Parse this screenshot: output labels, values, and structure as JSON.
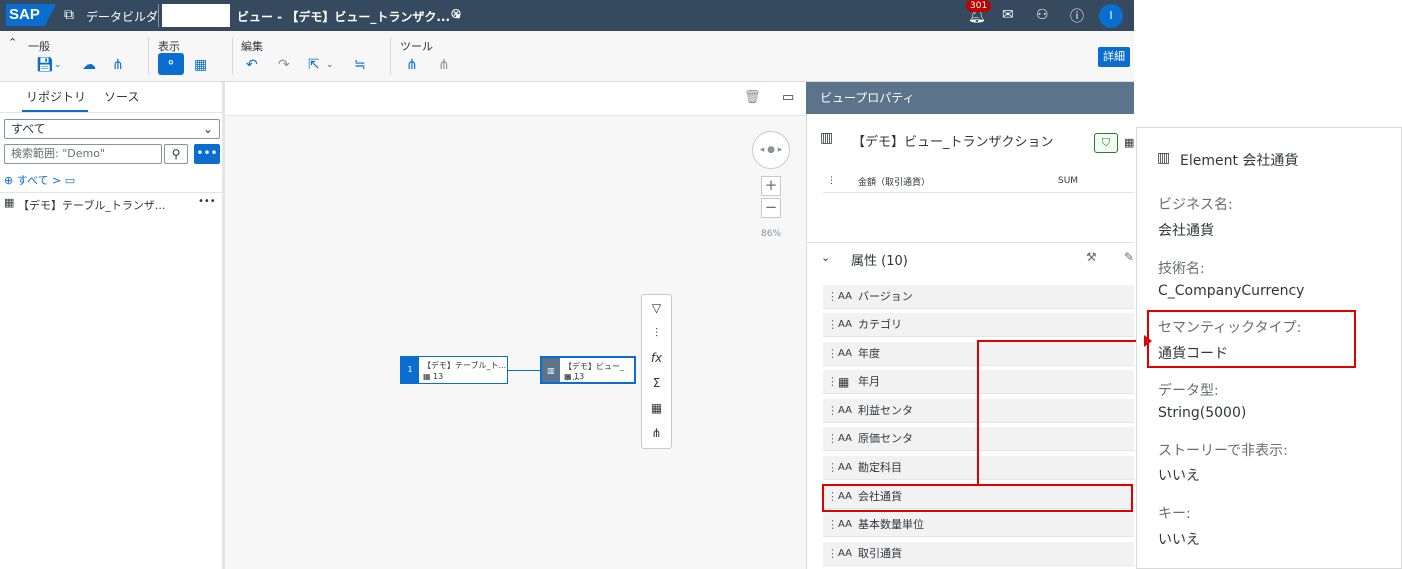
{
  "shell": {
    "logo": "SAP",
    "app_name": "データビルダ",
    "view_title": "ビュー - 【デモ】ビュー_トランザク... •",
    "notification_count": "301",
    "avatar_initial": "I"
  },
  "toolbar": {
    "groups": [
      "一般",
      "表示",
      "編集",
      "ツール"
    ],
    "detail_button": "詳細"
  },
  "left_panel": {
    "tabs": [
      "リポジトリ",
      "ソース"
    ],
    "filter_value": "すべて",
    "search_placeholder": "検索範囲: \"Demo\"",
    "breadcrumb": "すべて >",
    "items": [
      {
        "label": "【デモ】テーブル_トランザ..."
      }
    ]
  },
  "canvas": {
    "zoom": "86%",
    "source_node": {
      "number": "1",
      "title": "【デモ】テーブル_ト...",
      "count": "13"
    },
    "view_node": {
      "title": "【デモ】ビュー_ト...",
      "count": "13"
    }
  },
  "properties": {
    "header": "ビュープロパティ",
    "object_title": "【デモ】ビュー_トランザクション",
    "measure_row_label": "金額（取引通貨）",
    "measure_row_agg": "SUM",
    "attributes_heading": "属性 (10)",
    "attributes": [
      {
        "icon": "AA",
        "label": "バージョン"
      },
      {
        "icon": "AA",
        "label": "カテゴリ"
      },
      {
        "icon": "AA",
        "label": "年度"
      },
      {
        "icon": "calendar",
        "label": "年月"
      },
      {
        "icon": "AA",
        "label": "利益センタ"
      },
      {
        "icon": "AA",
        "label": "原価センタ"
      },
      {
        "icon": "AA",
        "label": "勘定科目"
      },
      {
        "icon": "AA",
        "label": "会社通貨"
      },
      {
        "icon": "AA",
        "label": "基本数量単位"
      },
      {
        "icon": "AA",
        "label": "取引通貨"
      }
    ]
  },
  "popover": {
    "title": "Element 会社通貨",
    "fields": [
      {
        "label": "ビジネス名:",
        "value": "会社通貨"
      },
      {
        "label": "技術名:",
        "value": "C_CompanyCurrency"
      },
      {
        "label": "セマンティックタイプ:",
        "value": "通貨コード"
      },
      {
        "label": "データ型:",
        "value": "String(5000)"
      },
      {
        "label": "ストーリーで非表示:",
        "value": "いいえ"
      },
      {
        "label": "キー:",
        "value": "いいえ"
      }
    ]
  },
  "colors": {
    "shell": "#354a5f",
    "accent": "#0a6ed1",
    "highlight": "#e00000",
    "props_header": "#5b738b"
  }
}
